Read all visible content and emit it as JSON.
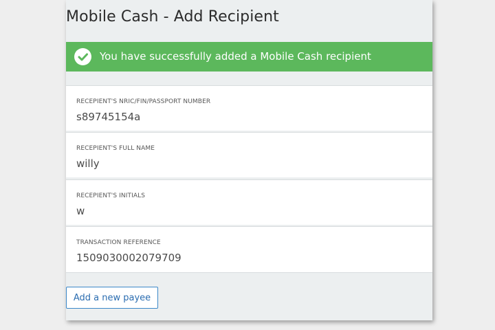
{
  "page": {
    "title": "Mobile Cash - Add Recipient"
  },
  "banner": {
    "message": "You have successfully added a Mobile Cash recipient",
    "icon": "check-circle-icon",
    "color": "#5cb85c"
  },
  "fields": [
    {
      "label": "Recepient's NRIC/FIN/Passport Number",
      "value": "s89745154a"
    },
    {
      "label": "Recepient's Full Name",
      "value": "willy"
    },
    {
      "label": "Recepient's Initials",
      "value": "w"
    },
    {
      "label": "Transaction Reference",
      "value": "1509030002079709"
    }
  ],
  "actions": {
    "add_payee_label": "Add a new payee"
  },
  "colors": {
    "button_border": "#3a87c8",
    "button_text": "#2a6cb0"
  }
}
